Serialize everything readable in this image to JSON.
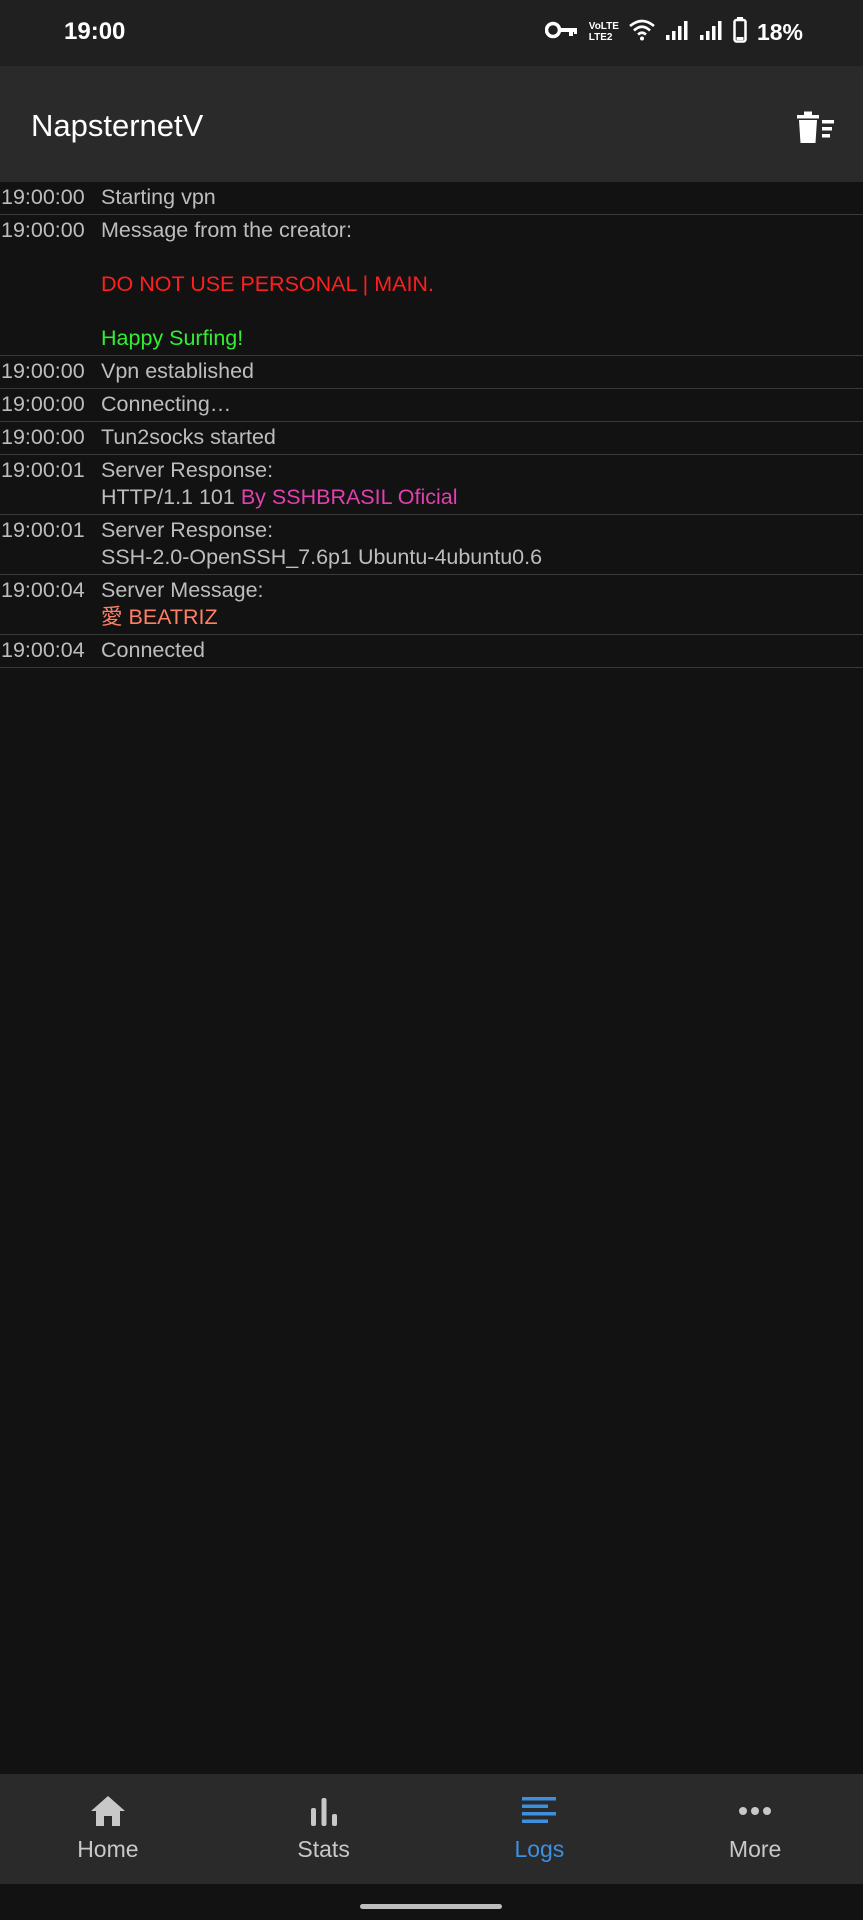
{
  "status_bar": {
    "time": "19:00",
    "lte_label": "LTE2",
    "volte_label": "VoLTE",
    "battery_percent": "18%",
    "icons": [
      "vpn-key-icon",
      "volte-lte-icon",
      "wifi-icon",
      "signal-1-icon",
      "signal-2-icon",
      "battery-icon"
    ]
  },
  "app_bar": {
    "title": "NapsternetV",
    "action_icon": "clear-logs-icon"
  },
  "logs": [
    {
      "time": "19:00:00",
      "text": "Starting vpn"
    },
    {
      "time": "19:00:00",
      "text": "Message from the creator:",
      "warning": "DO NOT USE PERSONAL | MAIN.",
      "greeting": "Happy Surfing!"
    },
    {
      "time": "19:00:00",
      "text": "Vpn established"
    },
    {
      "time": "19:00:00",
      "text": "Connecting…"
    },
    {
      "time": "19:00:00",
      "text": "Tun2socks started"
    },
    {
      "time": "19:00:01",
      "text": "Server Response:",
      "line2": "HTTP/1.1 101 ",
      "line2_highlight": "By SSHBRASIL Oficial"
    },
    {
      "time": "19:00:01",
      "text": "Server Response:",
      "line2": "SSH-2.0-OpenSSH_7.6p1 Ubuntu-4ubuntu0.6"
    },
    {
      "time": "19:00:04",
      "text": "Server Message:",
      "line2_highlight": "愛 BEATRIZ"
    },
    {
      "time": "19:00:04",
      "text": "Connected"
    }
  ],
  "bottom_nav": [
    {
      "label": "Home",
      "icon": "home-icon",
      "active": false
    },
    {
      "label": "Stats",
      "icon": "stats-icon",
      "active": false
    },
    {
      "label": "Logs",
      "icon": "logs-icon",
      "active": true
    },
    {
      "label": "More",
      "icon": "more-icon",
      "active": false
    }
  ],
  "colors": {
    "background": "#121212",
    "app_bar": "#2a2a2a",
    "active_tab": "#3d8fe0",
    "warning_red": "#ff1f1f",
    "greeting_green": "#33ee33",
    "highlight_pink": "#e040b0",
    "highlight_salmon": "#ff7f66"
  }
}
